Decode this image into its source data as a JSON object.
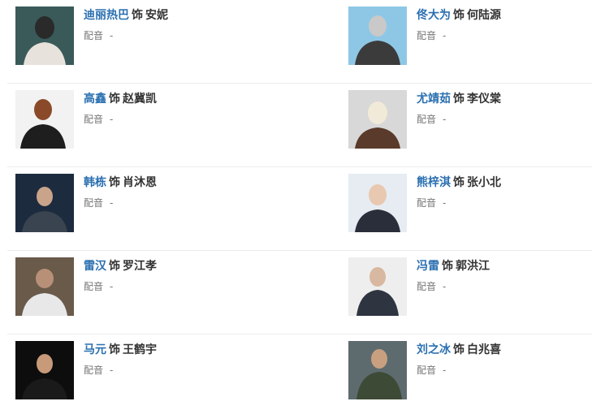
{
  "cast": [
    {
      "actor": "迪丽热巴",
      "sep": "饰",
      "role": "安妮",
      "dub_label": "配音",
      "dub_value": "-",
      "photo_colors": [
        "#3a5a5a",
        "#e8e2dc",
        "#2a2a2a"
      ]
    },
    {
      "actor": "佟大为",
      "sep": "饰",
      "role": "何陆源",
      "dub_label": "配音",
      "dub_value": "-",
      "photo_colors": [
        "#8ec7e6",
        "#3b3b3b",
        "#c9c9c9"
      ]
    },
    {
      "actor": "高鑫",
      "sep": "饰",
      "role": "赵冀凯",
      "dub_label": "配音",
      "dub_value": "-",
      "photo_colors": [
        "#f2f2f2",
        "#1e1e1e",
        "#8a4a2a"
      ]
    },
    {
      "actor": "尤靖茹",
      "sep": "饰",
      "role": "李仪棠",
      "dub_label": "配音",
      "dub_value": "-",
      "photo_colors": [
        "#d8d8d8",
        "#5a3a2a",
        "#f2ead8"
      ]
    },
    {
      "actor": "韩栋",
      "sep": "饰",
      "role": "肖沐恩",
      "dub_label": "配音",
      "dub_value": "-",
      "photo_colors": [
        "#1d2b3f",
        "#3a4450",
        "#c9a48a"
      ]
    },
    {
      "actor": "熊梓淇",
      "sep": "饰",
      "role": "张小北",
      "dub_label": "配音",
      "dub_value": "-",
      "photo_colors": [
        "#e6ecf2",
        "#2a2e3a",
        "#e8c8b0"
      ]
    },
    {
      "actor": "雷汉",
      "sep": "饰",
      "role": "罗江孝",
      "dub_label": "配音",
      "dub_value": "-",
      "photo_colors": [
        "#6a5a4a",
        "#e8e8e8",
        "#b89078"
      ]
    },
    {
      "actor": "冯雷",
      "sep": "饰",
      "role": "郭洪江",
      "dub_label": "配音",
      "dub_value": "-",
      "photo_colors": [
        "#eeeeee",
        "#2e3440",
        "#d8b8a0"
      ]
    },
    {
      "actor": "马元",
      "sep": "饰",
      "role": "王鹤宇",
      "dub_label": "配音",
      "dub_value": "-",
      "photo_colors": [
        "#0d0d0d",
        "#1a1a1a",
        "#c89a7a"
      ]
    },
    {
      "actor": "刘之冰",
      "sep": "饰",
      "role": "白兆喜",
      "dub_label": "配音",
      "dub_value": "-",
      "photo_colors": [
        "#5e6b6e",
        "#3d4a36",
        "#c8a080"
      ]
    }
  ]
}
